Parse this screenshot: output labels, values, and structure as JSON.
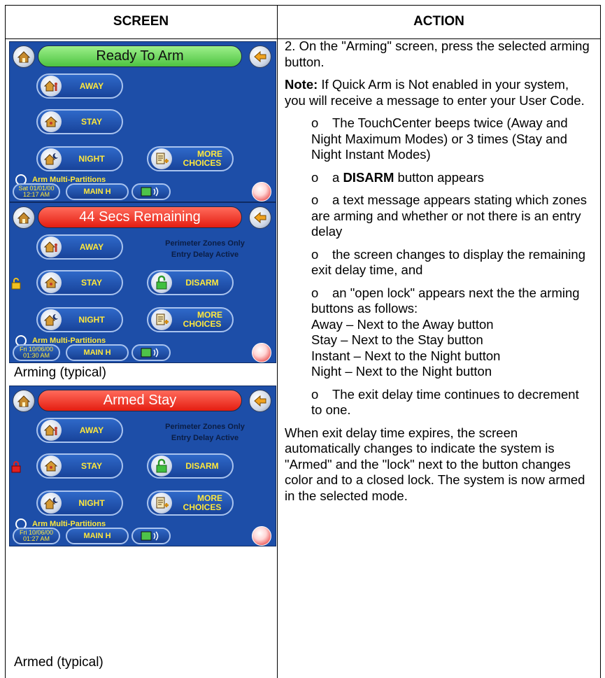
{
  "table": {
    "col_screen": "SCREEN",
    "col_action": "ACTION"
  },
  "panels": [
    {
      "banner": "Ready To Arm",
      "banner_color": "#4dc341",
      "away_label": "AWAY",
      "stay_label": "STAY",
      "night_label": "NIGHT",
      "more_label_1": "MORE",
      "more_label_2": "CHOICES",
      "multi": "Arm Multi-Partitions",
      "date_line_1": "Sat 01/01/00",
      "date_line_2": "12:17 AM",
      "main_label": "MAIN H"
    },
    {
      "banner": "44  Secs Remaining",
      "banner_color": "#e41d11",
      "away_label": "AWAY",
      "stay_label": "STAY",
      "disarm_label": "DISARM",
      "night_label": "NIGHT",
      "more_label_1": "MORE",
      "more_label_2": "CHOICES",
      "info_1": "Perimeter Zones Only",
      "info_2": "Entry Delay Active",
      "multi": "Arm Multi-Partitions",
      "date_line_1": "Fri 10/06/00",
      "date_line_2": "01:30 AM",
      "main_label": "MAIN H",
      "caption": "Arming (typical)"
    },
    {
      "banner": "Armed Stay",
      "banner_color": "#e41d11",
      "away_label": "AWAY",
      "stay_label": "STAY",
      "disarm_label": "DISARM",
      "night_label": "NIGHT",
      "more_label_1": "MORE",
      "more_label_2": "CHOICES",
      "info_1": "Perimeter Zones Only",
      "info_2": "Entry Delay Active",
      "multi": "Arm Multi-Partitions",
      "date_line_1": "Fri 10/06/00",
      "date_line_2": "01:27 AM",
      "main_label": "MAIN H",
      "caption": "Armed (typical)"
    }
  ],
  "action": {
    "step": "2.  On the \"Arming\" screen, press the selected arming button.",
    "note_label": "Note:",
    "note_text": " If Quick Arm is Not enabled in your system, you will receive a message to enter your User Code.",
    "bullet": "o",
    "b1": "The TouchCenter beeps twice (Away and Night Maximum Modes) or 3 times (Stay and Night Instant Modes)",
    "b2_pre": "a ",
    "b2_bold": "DISARM",
    "b2_post": " button appears",
    "b3": "a text message appears stating which zones are arming and whether or not there is an entry delay",
    "b4": "the screen changes to display the remaining exit delay time, and",
    "b5": "an \"open lock\" appears next the the arming buttons as follows:\nAway – Next to the Away button\nStay – Next to the Stay button\nInstant  – Next to the Night button\nNight – Next to the Night button",
    "b6": "The exit delay time continues to decrement to one.",
    "final": "When exit delay time expires, the screen automatically changes to indicate the system is \"Armed\" and the \"lock\" next to the button changes color and to a closed lock.  The system is now armed in the selected mode."
  }
}
